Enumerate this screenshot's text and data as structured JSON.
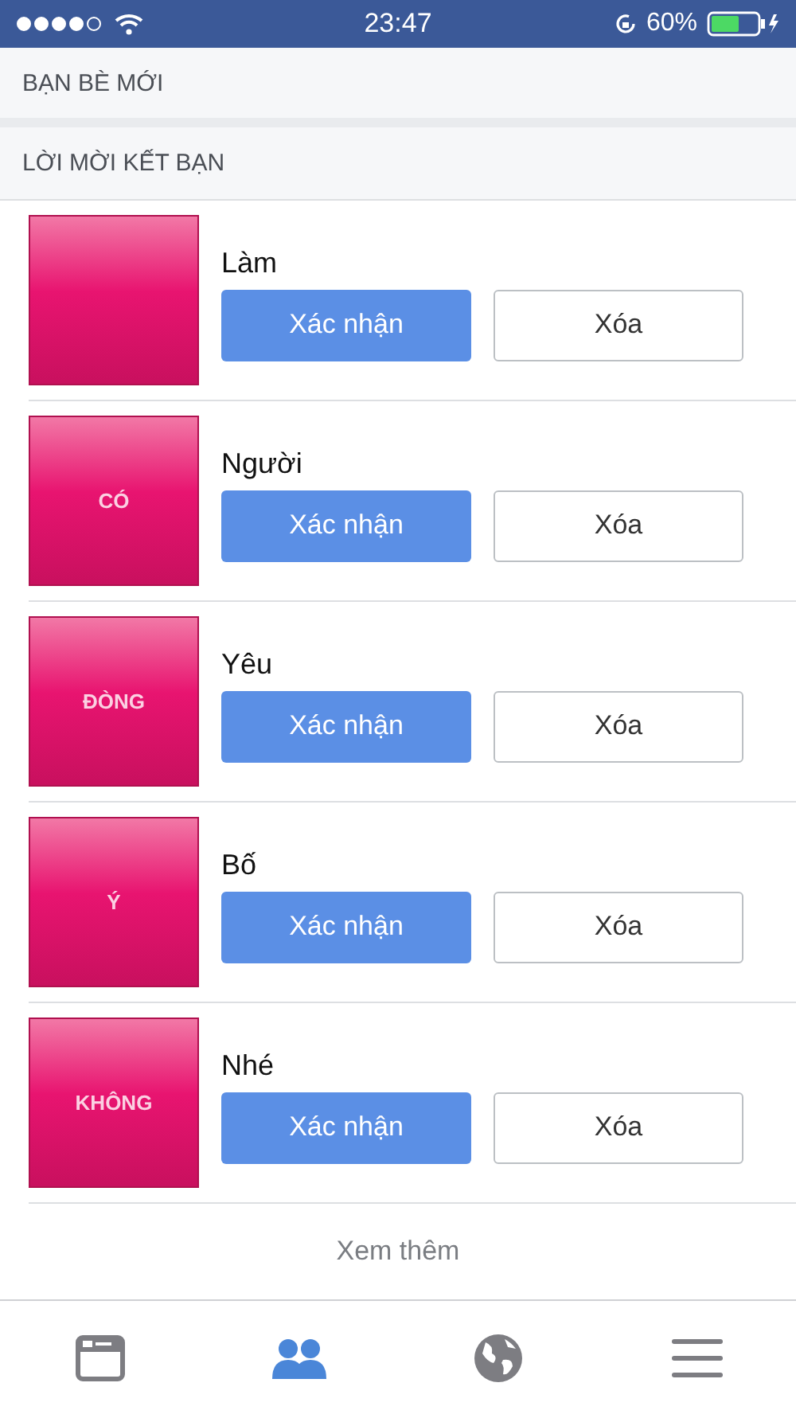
{
  "status_bar": {
    "time": "23:47",
    "battery": "60%"
  },
  "sections": [
    "BẠN BÈ MỚI",
    "LỜI MỜI KẾT BẠN"
  ],
  "requests": [
    {
      "name": "Làm",
      "confirm": "Xác nhận",
      "delete": "Xóa"
    },
    {
      "name": "Người",
      "avatar_text": "CÓ",
      "confirm": "Xác nhận",
      "delete": "Xóa"
    },
    {
      "name": "Yêu",
      "avatar_text": "ĐÒNG",
      "confirm": "Xác nhận",
      "delete": "Xóa"
    },
    {
      "name": "Bố",
      "avatar_text": "Ý",
      "confirm": "Xác nhận",
      "delete": "Xóa"
    },
    {
      "name": "Nhé",
      "avatar_text": "KHÔNG",
      "confirm": "Xác nhận",
      "delete": "Xóa"
    }
  ],
  "see_more": "Xem thêm",
  "tabs": [
    {
      "kind": "feed",
      "selected": false
    },
    {
      "kind": "friends",
      "selected": true
    },
    {
      "kind": "globe",
      "selected": false
    },
    {
      "kind": "menu",
      "selected": false
    }
  ]
}
